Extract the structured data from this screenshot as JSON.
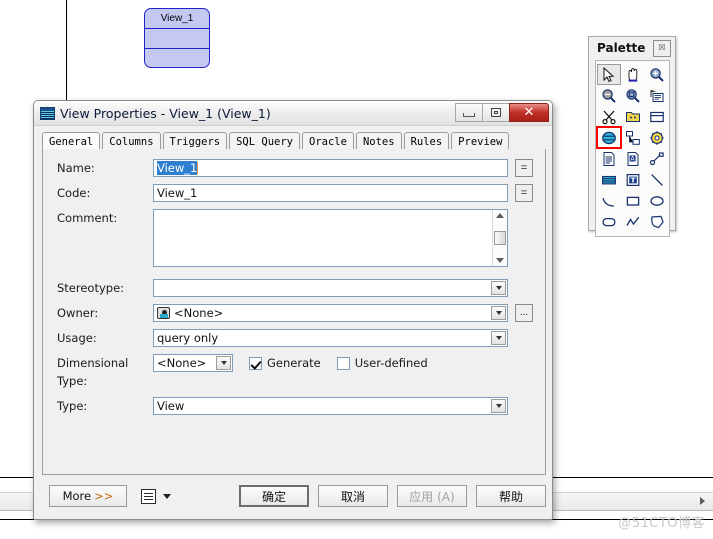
{
  "canvas": {
    "shape": {
      "label": "View_1"
    }
  },
  "palette": {
    "title": "Palette",
    "close_glyph": "☒",
    "tools": [
      {
        "name": "pointer-tool",
        "glyph": "➤",
        "selected": true,
        "highlighted": false
      },
      {
        "name": "pan-hand-tool",
        "glyph": "✋",
        "selected": false,
        "highlighted": false
      },
      {
        "name": "zoom-in-tool",
        "glyph": "⊕",
        "selected": false,
        "highlighted": false
      },
      {
        "name": "zoom-out-tool",
        "glyph": "⊖",
        "selected": false,
        "highlighted": false
      },
      {
        "name": "zoom-area-tool",
        "glyph": "▣",
        "selected": false,
        "highlighted": false
      },
      {
        "name": "properties-tool",
        "glyph": "▤",
        "selected": false,
        "highlighted": false
      },
      {
        "name": "scissors-cut-tool",
        "glyph": "✂",
        "selected": false,
        "highlighted": false
      },
      {
        "name": "package-tool",
        "glyph": "▥",
        "selected": false,
        "highlighted": false
      },
      {
        "name": "table-tool",
        "glyph": "▦",
        "selected": false,
        "highlighted": false
      },
      {
        "name": "view-tool",
        "glyph": "☲",
        "selected": false,
        "highlighted": true
      },
      {
        "name": "reference-tool",
        "glyph": "⊞",
        "selected": false,
        "highlighted": false
      },
      {
        "name": "procedure-gear-tool",
        "glyph": "⚙",
        "selected": false,
        "highlighted": false
      },
      {
        "name": "file-tool",
        "glyph": "▧",
        "selected": false,
        "highlighted": false
      },
      {
        "name": "text-file-tool",
        "glyph": "Ⓐ",
        "selected": false,
        "highlighted": false
      },
      {
        "name": "link-tool",
        "glyph": "⧉",
        "selected": false,
        "highlighted": false
      },
      {
        "name": "database-tool",
        "glyph": "≡",
        "selected": false,
        "highlighted": false
      },
      {
        "name": "title-text-tool",
        "glyph": "T",
        "selected": false,
        "highlighted": false
      },
      {
        "name": "line-tool",
        "glyph": "╲",
        "selected": false,
        "highlighted": false
      },
      {
        "name": "arc-tool",
        "glyph": "◜",
        "selected": false,
        "highlighted": false
      },
      {
        "name": "rectangle-tool",
        "glyph": "▭",
        "selected": false,
        "highlighted": false
      },
      {
        "name": "ellipse-tool",
        "glyph": "⬭",
        "selected": false,
        "highlighted": false
      },
      {
        "name": "rounded-rectangle-tool",
        "glyph": "▢",
        "selected": false,
        "highlighted": false
      },
      {
        "name": "polyline-tool",
        "glyph": "↗",
        "selected": false,
        "highlighted": false
      },
      {
        "name": "polygon-tool",
        "glyph": "⬠",
        "selected": false,
        "highlighted": false
      }
    ]
  },
  "dialog": {
    "title": "View Properties - View_1 (View_1)",
    "window_buttons": {
      "minimize": "–",
      "maximize": "□",
      "close": "✕"
    },
    "tabs": [
      {
        "label": "General",
        "active": true
      },
      {
        "label": "Columns",
        "active": false
      },
      {
        "label": "Triggers",
        "active": false
      },
      {
        "label": "SQL Query",
        "active": false
      },
      {
        "label": "Oracle",
        "active": false
      },
      {
        "label": "Notes",
        "active": false
      },
      {
        "label": "Rules",
        "active": false
      },
      {
        "label": "Preview",
        "active": false
      }
    ],
    "fields": {
      "name": {
        "label": "Name:",
        "value": "View_1",
        "selected": true,
        "button": "="
      },
      "code": {
        "label": "Code:",
        "value": "View_1",
        "button": "="
      },
      "comment": {
        "label": "Comment:",
        "value": ""
      },
      "stereotype": {
        "label": "Stereotype:",
        "value": ""
      },
      "owner": {
        "label": "Owner:",
        "value": "<None>",
        "more_button": "..."
      },
      "usage": {
        "label": "Usage:",
        "value": "query only"
      },
      "dimensional_type": {
        "label": "Dimensional Type:",
        "value": "<None>"
      },
      "generate": {
        "label": "Generate",
        "checked": true
      },
      "user_defined": {
        "label": "User-defined",
        "checked": false
      },
      "type": {
        "label": "Type:",
        "value": "View"
      }
    },
    "footer": {
      "more": "More",
      "more_chevrons": ">>",
      "ok": "确定",
      "cancel": "取消",
      "apply": "应用 (A)",
      "help": "帮助"
    }
  },
  "watermark": {
    "text": "@51CTO博客"
  }
}
